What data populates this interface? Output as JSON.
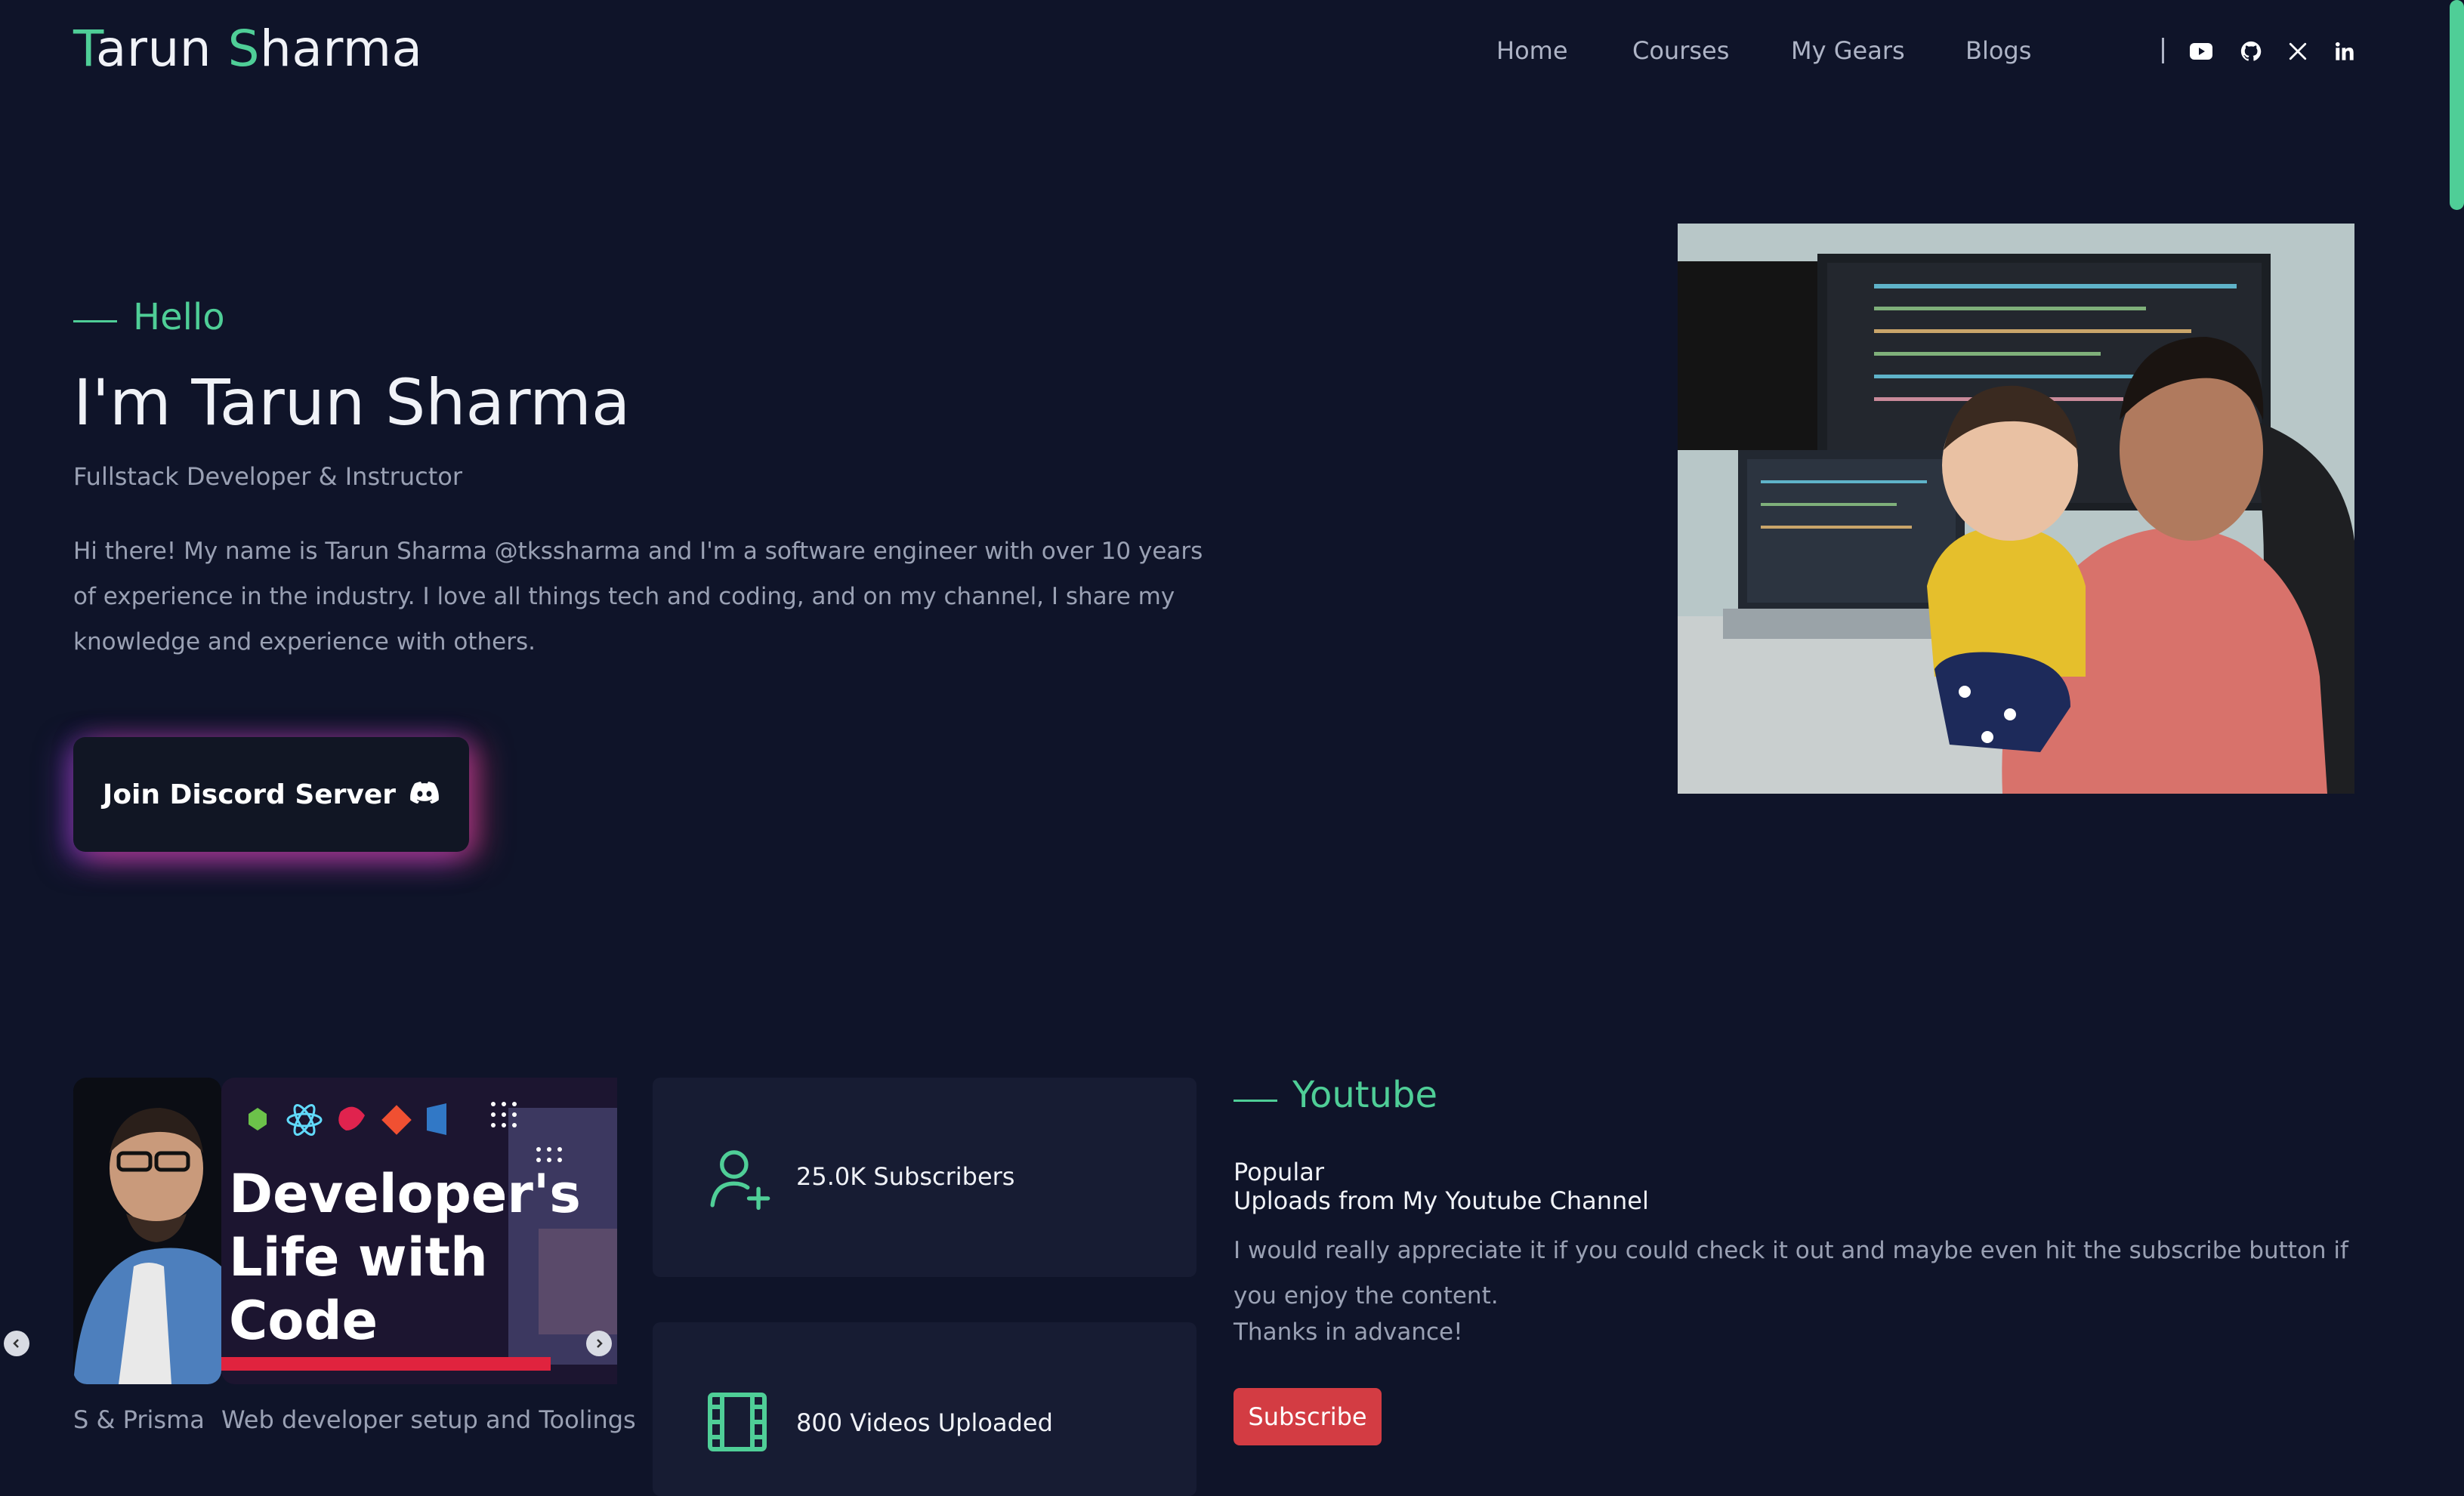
{
  "header": {
    "logo": {
      "first_initial": "T",
      "first_rest": "arun ",
      "last_initial": "S",
      "last_rest": "harma"
    },
    "nav": {
      "home": "Home",
      "courses": "Courses",
      "gears": "My Gears",
      "blogs": "Blogs"
    },
    "social_icons": [
      "youtube-icon",
      "github-icon",
      "x-icon",
      "linkedin-icon"
    ]
  },
  "hero": {
    "hello": "Hello",
    "title": "I'm Tarun Sharma",
    "subtitle": "Fullstack Developer & Instructor",
    "bio": "Hi there! My name is Tarun Sharma @tkssharma and I'm a software engineer with over 10 years of experience in the industry. I love all things tech and coding, and on my channel, I share my knowledge and experience with others.",
    "cta_label": "Join Discord Server"
  },
  "carousel": {
    "slide_title_lines": [
      "Developer's",
      "Life with",
      "Code"
    ],
    "captions": [
      "S & Prisma",
      "Web developer setup and Toolings"
    ]
  },
  "stats": {
    "subscribers": "25.0K Subscribers",
    "videos": "800 Videos Uploaded"
  },
  "youtube": {
    "heading": "Youtube",
    "popular": "Popular",
    "uploads": "Uploads from My Youtube Channel",
    "description": "I would really appreciate it if you could check it out and maybe even hit the subscribe button if you enjoy the content.",
    "thanks": "Thanks in advance!",
    "subscribe_label": "Subscribe"
  },
  "colors": {
    "accent": "#4fce97",
    "background": "#0f1429",
    "card": "#171c33",
    "subscribe": "#d33c43"
  }
}
